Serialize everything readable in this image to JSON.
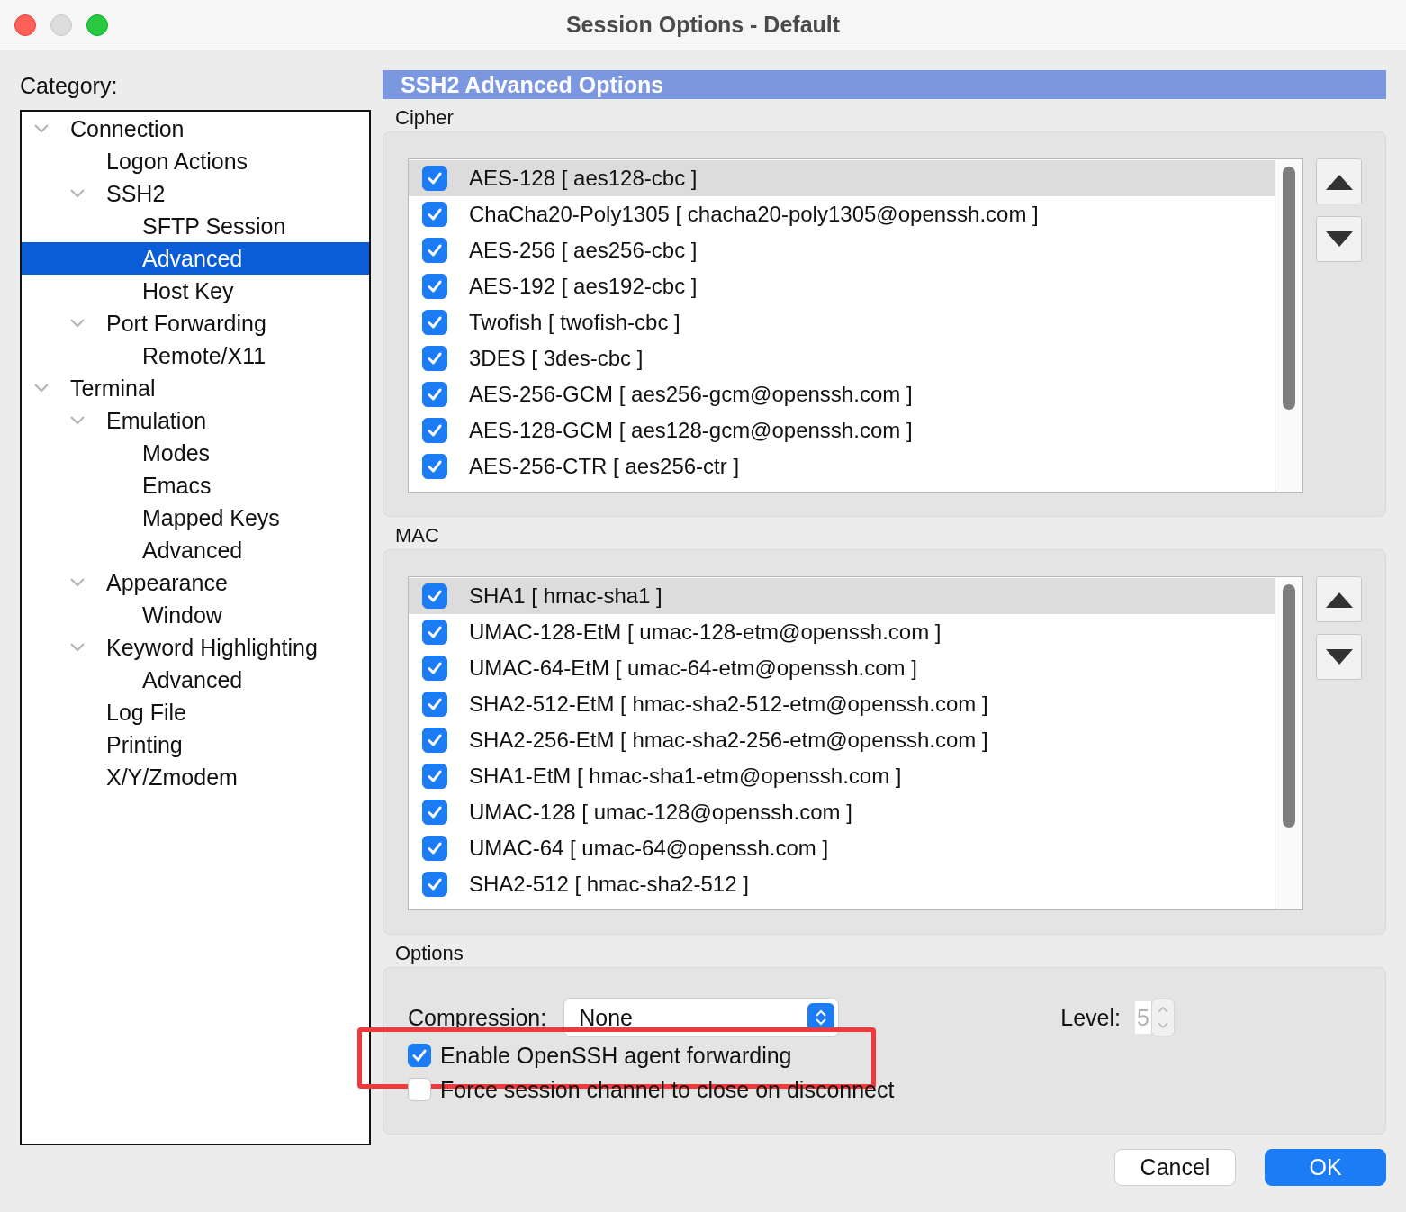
{
  "window": {
    "title": "Session Options - Default"
  },
  "category": {
    "label": "Category:",
    "tree": [
      {
        "label": "Connection",
        "expanded": true,
        "selected": false,
        "children": [
          {
            "label": "Logon Actions",
            "selected": false
          },
          {
            "label": "SSH2",
            "expanded": true,
            "selected": false,
            "children": [
              {
                "label": "SFTP Session",
                "selected": false
              },
              {
                "label": "Advanced",
                "selected": true
              },
              {
                "label": "Host Key",
                "selected": false
              }
            ]
          },
          {
            "label": "Port Forwarding",
            "expanded": true,
            "selected": false,
            "children": [
              {
                "label": "Remote/X11",
                "selected": false
              }
            ]
          }
        ]
      },
      {
        "label": "Terminal",
        "expanded": true,
        "selected": false,
        "children": [
          {
            "label": "Emulation",
            "expanded": true,
            "selected": false,
            "children": [
              {
                "label": "Modes",
                "selected": false
              },
              {
                "label": "Emacs",
                "selected": false
              },
              {
                "label": "Mapped Keys",
                "selected": false
              },
              {
                "label": "Advanced",
                "selected": false
              }
            ]
          },
          {
            "label": "Appearance",
            "expanded": true,
            "selected": false,
            "children": [
              {
                "label": "Window",
                "selected": false
              }
            ]
          },
          {
            "label": "Keyword Highlighting",
            "expanded": true,
            "selected": false,
            "children": [
              {
                "label": "Advanced",
                "selected": false
              }
            ]
          },
          {
            "label": "Log File",
            "selected": false
          },
          {
            "label": "Printing",
            "selected": false
          },
          {
            "label": "X/Y/Zmodem",
            "selected": false
          }
        ]
      }
    ]
  },
  "panel": {
    "title": "SSH2 Advanced Options",
    "lists": [
      {
        "label": "Cipher",
        "items": [
          {
            "text": "AES-128 [ aes128-cbc ]",
            "checked": true,
            "selected": true
          },
          {
            "text": "ChaCha20-Poly1305 [ chacha20-poly1305@openssh.com ]",
            "checked": true,
            "selected": false
          },
          {
            "text": "AES-256 [ aes256-cbc ]",
            "checked": true,
            "selected": false
          },
          {
            "text": "AES-192 [ aes192-cbc ]",
            "checked": true,
            "selected": false
          },
          {
            "text": "Twofish [ twofish-cbc ]",
            "checked": true,
            "selected": false
          },
          {
            "text": "3DES [ 3des-cbc ]",
            "checked": true,
            "selected": false
          },
          {
            "text": "AES-256-GCM [ aes256-gcm@openssh.com ]",
            "checked": true,
            "selected": false
          },
          {
            "text": "AES-128-GCM [ aes128-gcm@openssh.com ]",
            "checked": true,
            "selected": false
          },
          {
            "text": "AES-256-CTR [ aes256-ctr ]",
            "checked": true,
            "selected": false
          }
        ]
      },
      {
        "label": "MAC",
        "items": [
          {
            "text": "SHA1 [ hmac-sha1 ]",
            "checked": true,
            "selected": true
          },
          {
            "text": "UMAC-128-EtM [ umac-128-etm@openssh.com ]",
            "checked": true,
            "selected": false
          },
          {
            "text": "UMAC-64-EtM [ umac-64-etm@openssh.com ]",
            "checked": true,
            "selected": false
          },
          {
            "text": "SHA2-512-EtM [ hmac-sha2-512-etm@openssh.com ]",
            "checked": true,
            "selected": false
          },
          {
            "text": "SHA2-256-EtM [ hmac-sha2-256-etm@openssh.com ]",
            "checked": true,
            "selected": false
          },
          {
            "text": "SHA1-EtM [ hmac-sha1-etm@openssh.com ]",
            "checked": true,
            "selected": false
          },
          {
            "text": "UMAC-128 [ umac-128@openssh.com ]",
            "checked": true,
            "selected": false
          },
          {
            "text": "UMAC-64 [ umac-64@openssh.com ]",
            "checked": true,
            "selected": false
          },
          {
            "text": "SHA2-512 [ hmac-sha2-512 ]",
            "checked": true,
            "selected": false
          }
        ]
      }
    ],
    "options": {
      "label": "Options",
      "compression_label": "Compression:",
      "compression": "None",
      "level_label": "Level:",
      "level_value": "5",
      "level_disabled": true,
      "checkboxes": [
        {
          "label": "Enable OpenSSH agent forwarding",
          "checked": true,
          "highlighted": true
        },
        {
          "label": "Force session channel to close on disconnect",
          "checked": false,
          "highlighted": false
        }
      ]
    }
  },
  "buttons": [
    {
      "label": "Cancel",
      "default": false
    },
    {
      "label": "OK",
      "default": true
    }
  ]
}
